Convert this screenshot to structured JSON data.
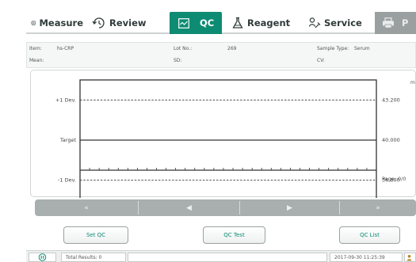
{
  "tabs": [
    {
      "label": "Measure",
      "icon": "measure-icon"
    },
    {
      "label": "Review",
      "icon": "review-icon"
    },
    {
      "label": "QC",
      "icon": "qc-icon",
      "active": true
    },
    {
      "label": "Reagent",
      "icon": "reagent-icon"
    },
    {
      "label": "Service",
      "icon": "service-icon"
    },
    {
      "label": "P",
      "icon": "printer-icon",
      "disabled": true
    }
  ],
  "info": {
    "item_label": "Item:",
    "item_value": "hs-CRP",
    "lot_label": "Lot No.:",
    "lot_value": "269",
    "sample_type_label": "Sample Type:",
    "sample_type_value": "Serum",
    "mean_label": "Mean:",
    "mean_value": "",
    "sd_label": "SD:",
    "sd_value": "",
    "cv_label": "CV:",
    "cv_value": ""
  },
  "chart": {
    "unit": "m",
    "rows": [
      {
        "label": "+1 Dev.",
        "value": "43.200",
        "style": "dashed"
      },
      {
        "label": "Target",
        "value": "40.000",
        "style": "solid"
      },
      {
        "label": "-1 Dev.",
        "value": "36.800",
        "style": "dashed"
      }
    ],
    "page": "Page: 0/0"
  },
  "chart_data": {
    "type": "line",
    "title": "",
    "xlabel": "",
    "ylabel": "m",
    "ylim": [
      35.2,
      44.8
    ],
    "reference_lines": [
      {
        "name": "+1 Dev.",
        "value": 43.2
      },
      {
        "name": "Target",
        "value": 40.0
      },
      {
        "name": "-1 Dev.",
        "value": 36.8
      }
    ],
    "series": [],
    "grid": false
  },
  "nav": {
    "first": "«",
    "prev": "◀",
    "next": "▶",
    "last": "»"
  },
  "buttons": {
    "set_qc": "Set QC",
    "qc_test": "QC Test",
    "qc_list": "QC List"
  },
  "status": {
    "total_results": "Total Results: 0",
    "datetime": "2017-09-30 11:25:39"
  },
  "colors": {
    "accent": "#0e8b73",
    "nav_bar": "#a9aeae"
  }
}
